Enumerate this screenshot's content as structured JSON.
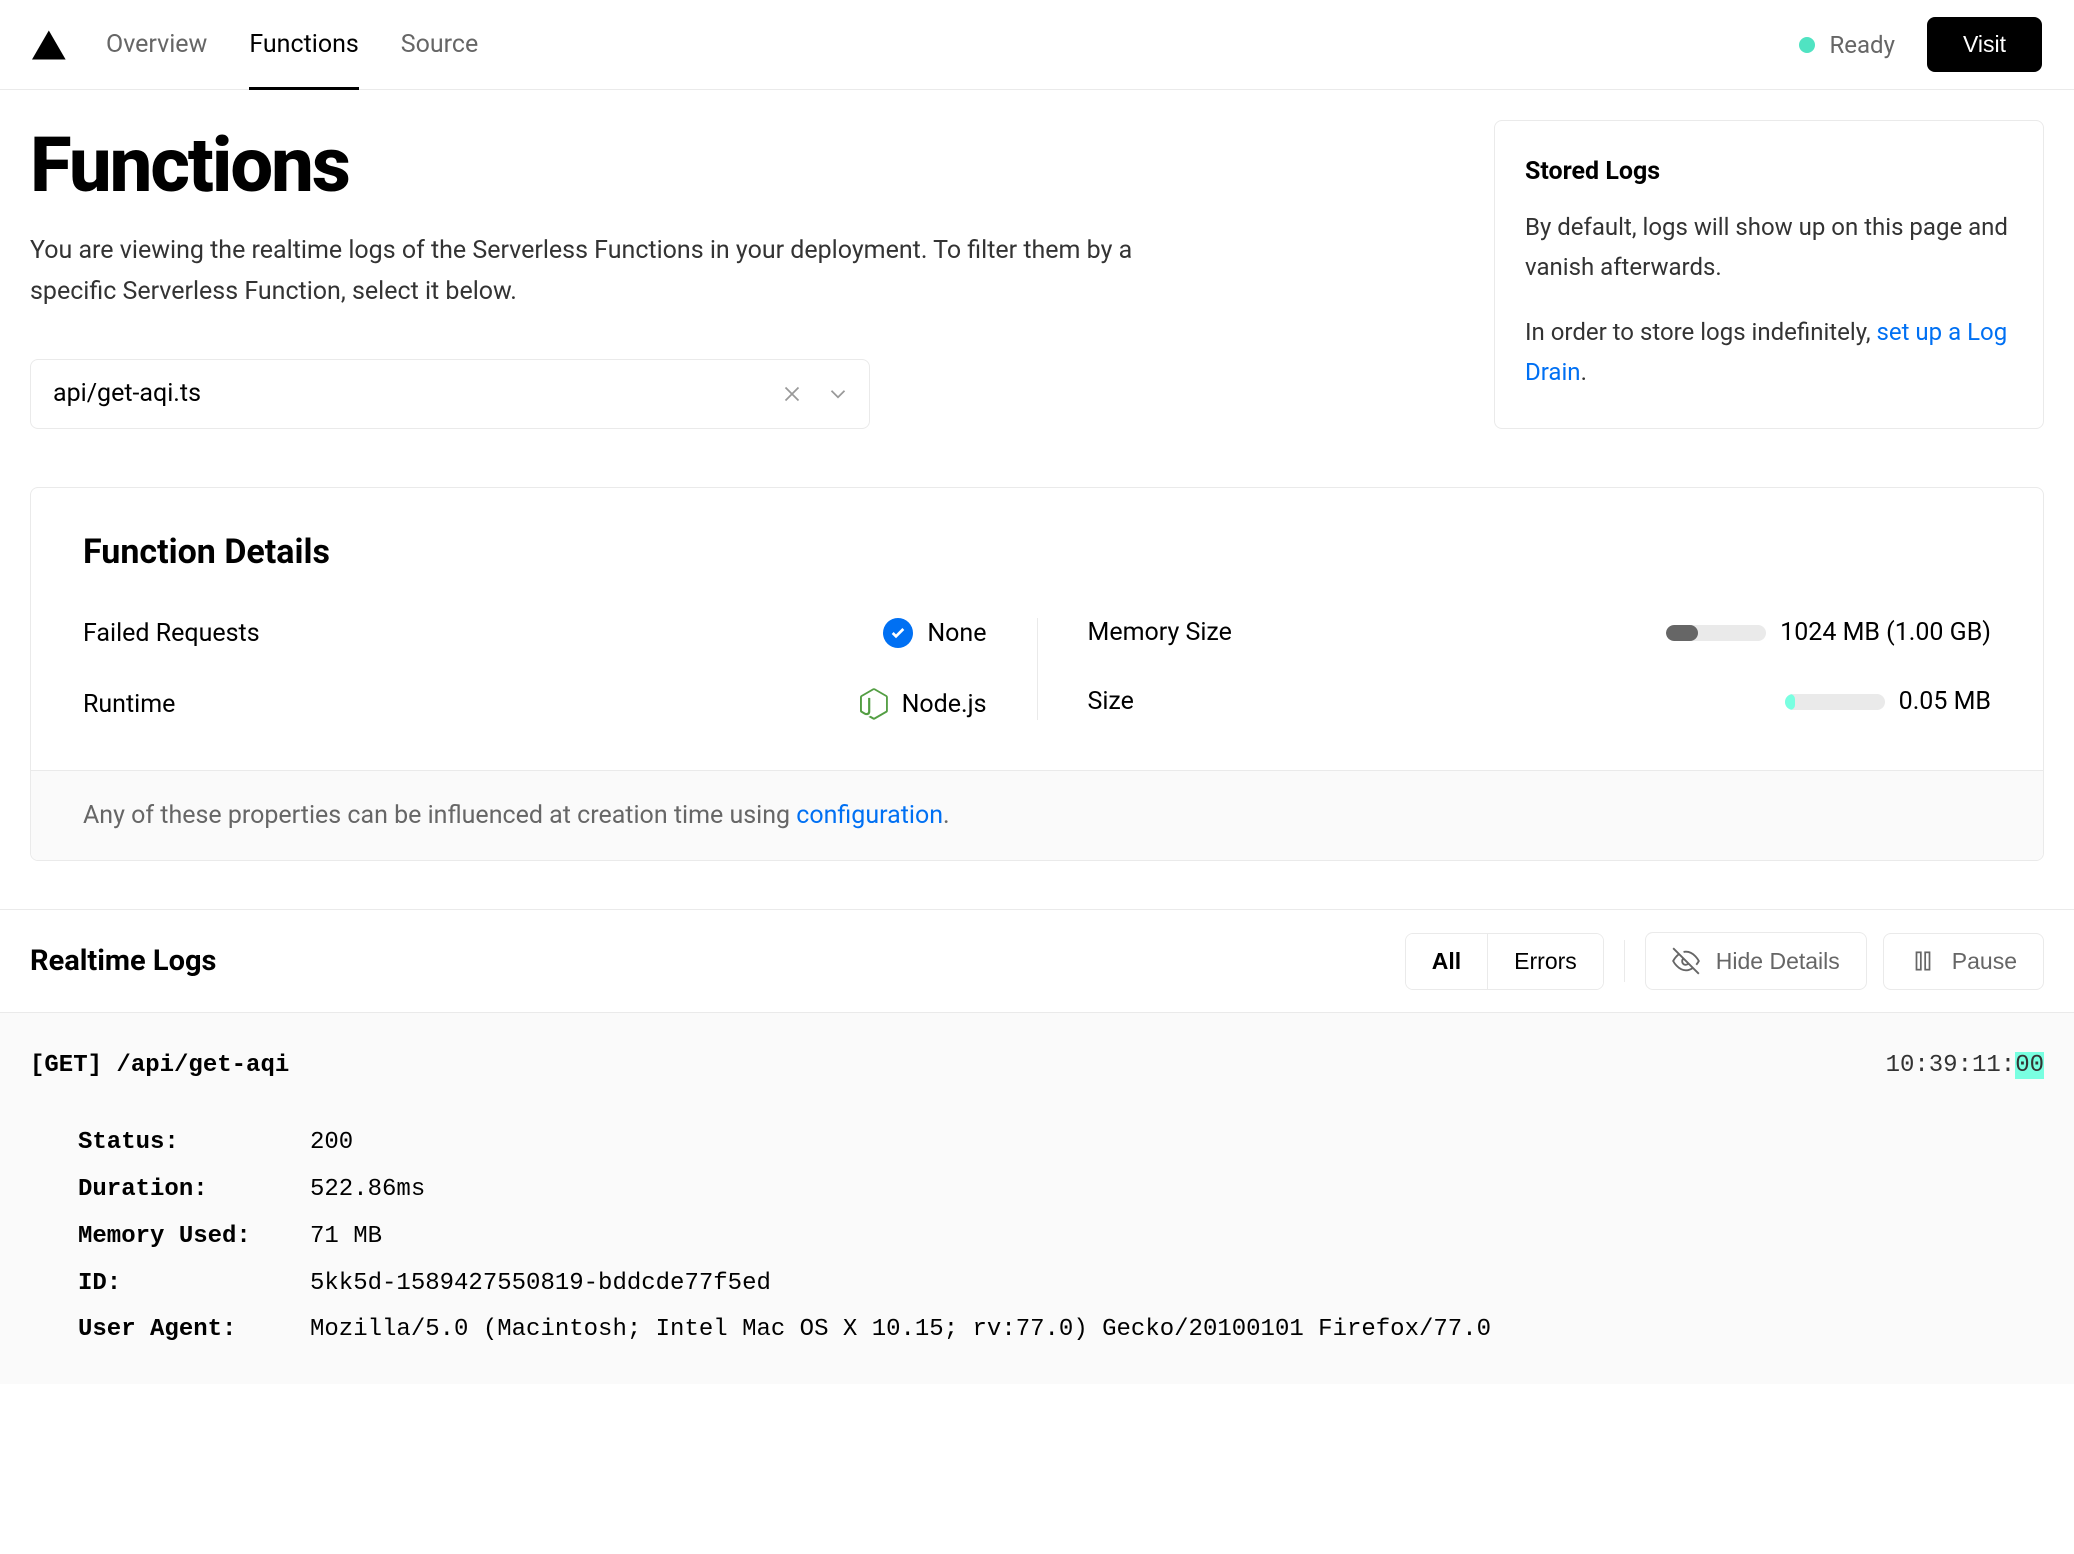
{
  "nav": {
    "tabs": [
      "Overview",
      "Functions",
      "Source"
    ],
    "active": 1
  },
  "header": {
    "status": "Ready",
    "visit_label": "Visit"
  },
  "page": {
    "title": "Functions",
    "subtitle": "You are viewing the realtime logs of the Serverless Functions in your deployment. To filter them by a specific Serverless Function, select it below."
  },
  "selector": {
    "value": "api/get-aqi.ts"
  },
  "stored_logs": {
    "title": "Stored Logs",
    "p1": "By default, logs will show up on this page and vanish afterwards.",
    "p2_prefix": "In order to store logs indefinitely, ",
    "p2_link": "set up a Log Drain",
    "p2_suffix": "."
  },
  "details": {
    "title": "Function Details",
    "rows": {
      "failed_requests": {
        "label": "Failed Requests",
        "value": "None"
      },
      "runtime": {
        "label": "Runtime",
        "value": "Node.js"
      },
      "memory_size": {
        "label": "Memory Size",
        "value": "1024 MB (1.00 GB)"
      },
      "size": {
        "label": "Size",
        "value": "0.05 MB"
      }
    },
    "footer_prefix": "Any of these properties can be influenced at creation time using ",
    "footer_link": "configuration",
    "footer_suffix": "."
  },
  "realtime": {
    "title": "Realtime Logs",
    "filters": {
      "all": "All",
      "errors": "Errors"
    },
    "hide_details": "Hide Details",
    "pause": "Pause"
  },
  "log": {
    "method": "[GET]",
    "path": "/api/get-aqi",
    "timestamp_prefix": "10:39:11:",
    "timestamp_hl": "00",
    "rows": {
      "status": {
        "key": "Status:",
        "value": "200"
      },
      "duration": {
        "key": "Duration:",
        "value": "522.86ms"
      },
      "memory_used": {
        "key": "Memory Used:",
        "value": "71 MB"
      },
      "id": {
        "key": "ID:",
        "value": "5kk5d-1589427550819-bddcde77f5ed"
      },
      "user_agent": {
        "key": "User Agent:",
        "value": "Mozilla/5.0 (Macintosh; Intel Mac OS X 10.15; rv:77.0) Gecko/20100101 Firefox/77.0"
      }
    }
  }
}
